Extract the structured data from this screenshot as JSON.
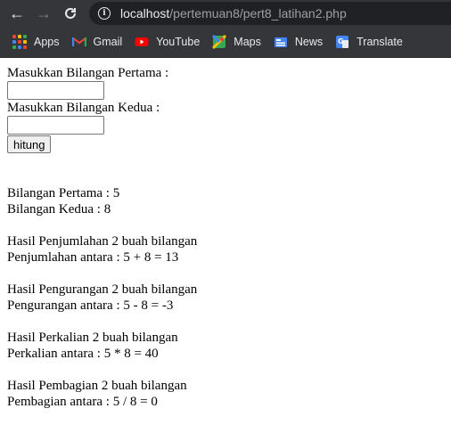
{
  "browser": {
    "url_host": "localhost",
    "url_path": "/pertemuan8/pert8_latihan2.php"
  },
  "bookmarks": [
    {
      "label": "Apps",
      "icon": "apps-grid-icon"
    },
    {
      "label": "Gmail",
      "icon": "gmail-icon"
    },
    {
      "label": "YouTube",
      "icon": "youtube-icon"
    },
    {
      "label": "Maps",
      "icon": "maps-icon"
    },
    {
      "label": "News",
      "icon": "news-icon"
    },
    {
      "label": "Translate",
      "icon": "translate-icon"
    }
  ],
  "form": {
    "label_first": "Masukkan Bilangan Pertama :",
    "value_first": "",
    "label_second": "Masukkan Bilangan Kedua :",
    "value_second": "",
    "button": "hitung"
  },
  "results": {
    "first": "Bilangan Pertama : 5",
    "second": "Bilangan Kedua : 8",
    "sum_title": "Hasil Penjumlahan 2 buah bilangan",
    "sum_line": "Penjumlahan antara : 5 + 8 = 13",
    "diff_title": "Hasil Pengurangan 2 buah bilangan",
    "diff_line": "Pengurangan antara : 5 - 8 = -3",
    "mul_title": "Hasil Perkalian 2 buah bilangan",
    "mul_line": "Perkalian antara : 5 * 8 = 40",
    "div_title": "Hasil Pembagian 2 buah bilangan",
    "div_line": "Pembagian antara : 5 / 8 = 0"
  }
}
